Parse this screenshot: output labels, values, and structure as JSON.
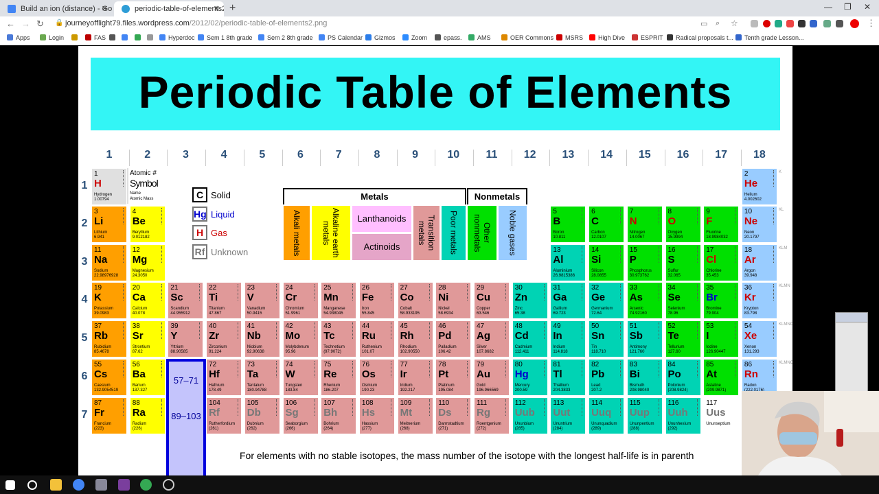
{
  "browser": {
    "tabs": [
      {
        "title": "Build an ion (distance) - Google",
        "favicon_color": "#4285f4"
      },
      {
        "title": "periodic-table-of-elements2.png",
        "favicon_color": "#2e9dd6"
      }
    ],
    "url_host": "journeyofflight79.files.wordpress.com",
    "url_path": "/2012/02/periodic-table-of-elements2.png",
    "bookmarks": [
      "Apps",
      "Login",
      "FAS",
      "",
      "",
      "",
      "Hyperdoc",
      "Sem 1 8th grade",
      "Sem 2 8th grade",
      "PS Calendar",
      "Gizmos",
      "Zoom",
      "epass.",
      "AMS",
      "OER Commons",
      "MSRS",
      "High Dive",
      "ESPRIT",
      "Radical proposals t...",
      "Tenth grade Lesson..."
    ]
  },
  "page": {
    "title": "Periodic Table of Elements",
    "groups": [
      "1",
      "2",
      "3",
      "4",
      "5",
      "6",
      "7",
      "8",
      "9",
      "10",
      "11",
      "12",
      "13",
      "14",
      "15",
      "16",
      "17",
      "18"
    ],
    "periods": [
      "1",
      "2",
      "3",
      "4",
      "5",
      "6",
      "7"
    ],
    "legend": {
      "atomic_label": "Atomic #",
      "symbol_label": "Symbol",
      "name_label": "Name",
      "mass_label": "Atomic Mass",
      "states": [
        {
          "sym": "C",
          "label": "Solid",
          "color": "#000000"
        },
        {
          "sym": "Hg",
          "label": "Liquid",
          "color": "#0000cc"
        },
        {
          "sym": "H",
          "label": "Gas",
          "color": "#cc0000"
        },
        {
          "sym": "Rf",
          "label": "Unknown",
          "color": "#777777"
        }
      ],
      "metals_header": "Metals",
      "nonmetals_header": "Nonmetals",
      "categories": [
        "Alkali metals",
        "Alkaline earth metals",
        "Lanthanoids",
        "Actinoids",
        "Transition metals",
        "Poor metals",
        "Other nonmetals",
        "Noble gases"
      ]
    },
    "lanthanoid_range": "57–71",
    "actinoid_range": "89–103",
    "footnote": "For elements with no stable isotopes, the mass number of the isotope with the longest half-life is in parenth",
    "shell_labels": [
      "K",
      "KL",
      "KLM",
      "KLMN",
      "KLMNO",
      "KLMNOP",
      "KLMNOPQ"
    ]
  },
  "colors": {
    "alkali": "#ff9f00",
    "alkaline": "#ffff00",
    "transition": "#e09999",
    "poor": "#00d3b4",
    "nonmetal": "#00e000",
    "noble": "#99ccff",
    "lanthanoid": "#ffbfff",
    "actinoid": "#e5a5c8",
    "halogen": "#f7ff46",
    "unknown": "#e8e8e8",
    "hydrogen": "#e0e0e0",
    "cyan": "#33f5f5"
  },
  "elements": [
    {
      "z": "1",
      "s": "H",
      "n": "Hydrogen",
      "m": "1.00794",
      "g": 1,
      "p": 1,
      "c": "hydrogen",
      "st": "gas"
    },
    {
      "z": "2",
      "s": "He",
      "n": "Helium",
      "m": "4.002602",
      "g": 18,
      "p": 1,
      "c": "noble",
      "st": "gas"
    },
    {
      "z": "3",
      "s": "Li",
      "n": "Lithium",
      "m": "6.941",
      "g": 1,
      "p": 2,
      "c": "alkali",
      "st": "solid"
    },
    {
      "z": "4",
      "s": "Be",
      "n": "Beryllium",
      "m": "9.012182",
      "g": 2,
      "p": 2,
      "c": "alkaline",
      "st": "solid"
    },
    {
      "z": "5",
      "s": "B",
      "n": "Boron",
      "m": "10.811",
      "g": 13,
      "p": 2,
      "c": "nonmetal",
      "st": "solid"
    },
    {
      "z": "6",
      "s": "C",
      "n": "Carbon",
      "m": "12.0107",
      "g": 14,
      "p": 2,
      "c": "nonmetal",
      "st": "solid"
    },
    {
      "z": "7",
      "s": "N",
      "n": "Nitrogen",
      "m": "14.0067",
      "g": 15,
      "p": 2,
      "c": "nonmetal",
      "st": "gas"
    },
    {
      "z": "8",
      "s": "O",
      "n": "Oxygen",
      "m": "15.9994",
      "g": 16,
      "p": 2,
      "c": "nonmetal",
      "st": "gas"
    },
    {
      "z": "9",
      "s": "F",
      "n": "Fluorine",
      "m": "18.9984032",
      "g": 17,
      "p": 2,
      "c": "nonmetal",
      "st": "gas"
    },
    {
      "z": "10",
      "s": "Ne",
      "n": "Neon",
      "m": "20.1797",
      "g": 18,
      "p": 2,
      "c": "noble",
      "st": "gas"
    },
    {
      "z": "11",
      "s": "Na",
      "n": "Sodium",
      "m": "22.98976928",
      "g": 1,
      "p": 3,
      "c": "alkali",
      "st": "solid"
    },
    {
      "z": "12",
      "s": "Mg",
      "n": "Magnesium",
      "m": "24.3050",
      "g": 2,
      "p": 3,
      "c": "alkaline",
      "st": "solid"
    },
    {
      "z": "13",
      "s": "Al",
      "n": "Aluminium",
      "m": "26.9815386",
      "g": 13,
      "p": 3,
      "c": "poor",
      "st": "solid"
    },
    {
      "z": "14",
      "s": "Si",
      "n": "Silicon",
      "m": "28.0855",
      "g": 14,
      "p": 3,
      "c": "nonmetal",
      "st": "solid"
    },
    {
      "z": "15",
      "s": "P",
      "n": "Phosphorus",
      "m": "30.973762",
      "g": 15,
      "p": 3,
      "c": "nonmetal",
      "st": "solid"
    },
    {
      "z": "16",
      "s": "S",
      "n": "Sulfur",
      "m": "32.065",
      "g": 16,
      "p": 3,
      "c": "nonmetal",
      "st": "solid"
    },
    {
      "z": "17",
      "s": "Cl",
      "n": "Chlorine",
      "m": "35.453",
      "g": 17,
      "p": 3,
      "c": "nonmetal",
      "st": "gas"
    },
    {
      "z": "18",
      "s": "Ar",
      "n": "Argon",
      "m": "39.948",
      "g": 18,
      "p": 3,
      "c": "noble",
      "st": "gas"
    },
    {
      "z": "19",
      "s": "K",
      "n": "Potassium",
      "m": "39.0983",
      "g": 1,
      "p": 4,
      "c": "alkali",
      "st": "solid"
    },
    {
      "z": "20",
      "s": "Ca",
      "n": "Calcium",
      "m": "40.078",
      "g": 2,
      "p": 4,
      "c": "alkaline",
      "st": "solid"
    },
    {
      "z": "21",
      "s": "Sc",
      "n": "Scandium",
      "m": "44.955912",
      "g": 3,
      "p": 4,
      "c": "transition",
      "st": "solid"
    },
    {
      "z": "22",
      "s": "Ti",
      "n": "Titanium",
      "m": "47.867",
      "g": 4,
      "p": 4,
      "c": "transition",
      "st": "solid"
    },
    {
      "z": "23",
      "s": "V",
      "n": "Vanadium",
      "m": "50.9415",
      "g": 5,
      "p": 4,
      "c": "transition",
      "st": "solid"
    },
    {
      "z": "24",
      "s": "Cr",
      "n": "Chromium",
      "m": "51.9961",
      "g": 6,
      "p": 4,
      "c": "transition",
      "st": "solid"
    },
    {
      "z": "25",
      "s": "Mn",
      "n": "Manganese",
      "m": "54.938045",
      "g": 7,
      "p": 4,
      "c": "transition",
      "st": "solid"
    },
    {
      "z": "26",
      "s": "Fe",
      "n": "Iron",
      "m": "55.845",
      "g": 8,
      "p": 4,
      "c": "transition",
      "st": "solid"
    },
    {
      "z": "27",
      "s": "Co",
      "n": "Cobalt",
      "m": "58.933195",
      "g": 9,
      "p": 4,
      "c": "transition",
      "st": "solid"
    },
    {
      "z": "28",
      "s": "Ni",
      "n": "Nickel",
      "m": "58.6934",
      "g": 10,
      "p": 4,
      "c": "transition",
      "st": "solid"
    },
    {
      "z": "29",
      "s": "Cu",
      "n": "Copper",
      "m": "63.546",
      "g": 11,
      "p": 4,
      "c": "transition",
      "st": "solid"
    },
    {
      "z": "30",
      "s": "Zn",
      "n": "Zinc",
      "m": "65.38",
      "g": 12,
      "p": 4,
      "c": "poor",
      "st": "solid"
    },
    {
      "z": "31",
      "s": "Ga",
      "n": "Gallium",
      "m": "69.723",
      "g": 13,
      "p": 4,
      "c": "poor",
      "st": "solid"
    },
    {
      "z": "32",
      "s": "Ge",
      "n": "Germanium",
      "m": "72.64",
      "g": 14,
      "p": 4,
      "c": "poor",
      "st": "solid"
    },
    {
      "z": "33",
      "s": "As",
      "n": "Arsenic",
      "m": "74.92160",
      "g": 15,
      "p": 4,
      "c": "nonmetal",
      "st": "solid"
    },
    {
      "z": "34",
      "s": "Se",
      "n": "Selenium",
      "m": "78.96",
      "g": 16,
      "p": 4,
      "c": "nonmetal",
      "st": "solid"
    },
    {
      "z": "35",
      "s": "Br",
      "n": "Bromine",
      "m": "79.904",
      "g": 17,
      "p": 4,
      "c": "nonmetal",
      "st": "liquid"
    },
    {
      "z": "36",
      "s": "Kr",
      "n": "Krypton",
      "m": "83.798",
      "g": 18,
      "p": 4,
      "c": "noble",
      "st": "gas"
    },
    {
      "z": "37",
      "s": "Rb",
      "n": "Rubidium",
      "m": "85.4678",
      "g": 1,
      "p": 5,
      "c": "alkali",
      "st": "solid"
    },
    {
      "z": "38",
      "s": "Sr",
      "n": "Strontium",
      "m": "87.62",
      "g": 2,
      "p": 5,
      "c": "alkaline",
      "st": "solid"
    },
    {
      "z": "39",
      "s": "Y",
      "n": "Yttrium",
      "m": "88.90585",
      "g": 3,
      "p": 5,
      "c": "transition",
      "st": "solid"
    },
    {
      "z": "40",
      "s": "Zr",
      "n": "Zirconium",
      "m": "91.224",
      "g": 4,
      "p": 5,
      "c": "transition",
      "st": "solid"
    },
    {
      "z": "41",
      "s": "Nb",
      "n": "Niobium",
      "m": "92.90638",
      "g": 5,
      "p": 5,
      "c": "transition",
      "st": "solid"
    },
    {
      "z": "42",
      "s": "Mo",
      "n": "Molybdenum",
      "m": "95.96",
      "g": 6,
      "p": 5,
      "c": "transition",
      "st": "solid"
    },
    {
      "z": "43",
      "s": "Tc",
      "n": "Technetium",
      "m": "(97.9072)",
      "g": 7,
      "p": 5,
      "c": "transition",
      "st": "solid"
    },
    {
      "z": "44",
      "s": "Ru",
      "n": "Ruthenium",
      "m": "101.07",
      "g": 8,
      "p": 5,
      "c": "transition",
      "st": "solid"
    },
    {
      "z": "45",
      "s": "Rh",
      "n": "Rhodium",
      "m": "102.90550",
      "g": 9,
      "p": 5,
      "c": "transition",
      "st": "solid"
    },
    {
      "z": "46",
      "s": "Pd",
      "n": "Palladium",
      "m": "106.42",
      "g": 10,
      "p": 5,
      "c": "transition",
      "st": "solid"
    },
    {
      "z": "47",
      "s": "Ag",
      "n": "Silver",
      "m": "107.8682",
      "g": 11,
      "p": 5,
      "c": "transition",
      "st": "solid"
    },
    {
      "z": "48",
      "s": "Cd",
      "n": "Cadmium",
      "m": "112.411",
      "g": 12,
      "p": 5,
      "c": "poor",
      "st": "solid"
    },
    {
      "z": "49",
      "s": "In",
      "n": "Indium",
      "m": "114.818",
      "g": 13,
      "p": 5,
      "c": "poor",
      "st": "solid"
    },
    {
      "z": "50",
      "s": "Sn",
      "n": "Tin",
      "m": "118.710",
      "g": 14,
      "p": 5,
      "c": "poor",
      "st": "solid"
    },
    {
      "z": "51",
      "s": "Sb",
      "n": "Antimony",
      "m": "121.760",
      "g": 15,
      "p": 5,
      "c": "poor",
      "st": "solid"
    },
    {
      "z": "52",
      "s": "Te",
      "n": "Tellurium",
      "m": "127.60",
      "g": 16,
      "p": 5,
      "c": "nonmetal",
      "st": "solid"
    },
    {
      "z": "53",
      "s": "I",
      "n": "Iodine",
      "m": "126.90447",
      "g": 17,
      "p": 5,
      "c": "nonmetal",
      "st": "solid"
    },
    {
      "z": "54",
      "s": "Xe",
      "n": "Xenon",
      "m": "131.293",
      "g": 18,
      "p": 5,
      "c": "noble",
      "st": "gas"
    },
    {
      "z": "55",
      "s": "Cs",
      "n": "Caesium",
      "m": "132.9054519",
      "g": 1,
      "p": 6,
      "c": "alkali",
      "st": "solid"
    },
    {
      "z": "56",
      "s": "Ba",
      "n": "Barium",
      "m": "137.327",
      "g": 2,
      "p": 6,
      "c": "alkaline",
      "st": "solid"
    },
    {
      "z": "72",
      "s": "Hf",
      "n": "Hafnium",
      "m": "178.49",
      "g": 4,
      "p": 6,
      "c": "transition",
      "st": "solid"
    },
    {
      "z": "73",
      "s": "Ta",
      "n": "Tantalum",
      "m": "180.94788",
      "g": 5,
      "p": 6,
      "c": "transition",
      "st": "solid"
    },
    {
      "z": "74",
      "s": "W",
      "n": "Tungsten",
      "m": "183.84",
      "g": 6,
      "p": 6,
      "c": "transition",
      "st": "solid"
    },
    {
      "z": "75",
      "s": "Re",
      "n": "Rhenium",
      "m": "186.207",
      "g": 7,
      "p": 6,
      "c": "transition",
      "st": "solid"
    },
    {
      "z": "76",
      "s": "Os",
      "n": "Osmium",
      "m": "190.23",
      "g": 8,
      "p": 6,
      "c": "transition",
      "st": "solid"
    },
    {
      "z": "77",
      "s": "Ir",
      "n": "Iridium",
      "m": "192.217",
      "g": 9,
      "p": 6,
      "c": "transition",
      "st": "solid"
    },
    {
      "z": "78",
      "s": "Pt",
      "n": "Platinum",
      "m": "195.084",
      "g": 10,
      "p": 6,
      "c": "transition",
      "st": "solid"
    },
    {
      "z": "79",
      "s": "Au",
      "n": "Gold",
      "m": "196.966569",
      "g": 11,
      "p": 6,
      "c": "transition",
      "st": "solid"
    },
    {
      "z": "80",
      "s": "Hg",
      "n": "Mercury",
      "m": "200.59",
      "g": 12,
      "p": 6,
      "c": "poor",
      "st": "liquid"
    },
    {
      "z": "81",
      "s": "Tl",
      "n": "Thallium",
      "m": "204.3833",
      "g": 13,
      "p": 6,
      "c": "poor",
      "st": "solid"
    },
    {
      "z": "82",
      "s": "Pb",
      "n": "Lead",
      "m": "207.2",
      "g": 14,
      "p": 6,
      "c": "poor",
      "st": "solid"
    },
    {
      "z": "83",
      "s": "Bi",
      "n": "Bismuth",
      "m": "208.98040",
      "g": 15,
      "p": 6,
      "c": "poor",
      "st": "solid"
    },
    {
      "z": "84",
      "s": "Po",
      "n": "Polonium",
      "m": "(208.9824)",
      "g": 16,
      "p": 6,
      "c": "poor",
      "st": "solid"
    },
    {
      "z": "85",
      "s": "At",
      "n": "Astatine",
      "m": "(209.9871)",
      "g": 17,
      "p": 6,
      "c": "nonmetal",
      "st": "solid"
    },
    {
      "z": "86",
      "s": "Rn",
      "n": "Radon",
      "m": "(222.0176)",
      "g": 18,
      "p": 6,
      "c": "noble",
      "st": "gas"
    },
    {
      "z": "87",
      "s": "Fr",
      "n": "Francium",
      "m": "(223)",
      "g": 1,
      "p": 7,
      "c": "alkali",
      "st": "solid"
    },
    {
      "z": "88",
      "s": "Ra",
      "n": "Radium",
      "m": "(226)",
      "g": 2,
      "p": 7,
      "c": "alkaline",
      "st": "solid"
    },
    {
      "z": "104",
      "s": "Rf",
      "n": "Rutherfordium",
      "m": "(261)",
      "g": 4,
      "p": 7,
      "c": "transition",
      "st": "unknown"
    },
    {
      "z": "105",
      "s": "Db",
      "n": "Dubnium",
      "m": "(262)",
      "g": 5,
      "p": 7,
      "c": "transition",
      "st": "unknown"
    },
    {
      "z": "106",
      "s": "Sg",
      "n": "Seaborgium",
      "m": "(266)",
      "g": 6,
      "p": 7,
      "c": "transition",
      "st": "unknown"
    },
    {
      "z": "107",
      "s": "Bh",
      "n": "Bohrium",
      "m": "(264)",
      "g": 7,
      "p": 7,
      "c": "transition",
      "st": "unknown"
    },
    {
      "z": "108",
      "s": "Hs",
      "n": "Hassium",
      "m": "(277)",
      "g": 8,
      "p": 7,
      "c": "transition",
      "st": "unknown"
    },
    {
      "z": "109",
      "s": "Mt",
      "n": "Meitnerium",
      "m": "(268)",
      "g": 9,
      "p": 7,
      "c": "transition",
      "st": "unknown"
    },
    {
      "z": "110",
      "s": "Ds",
      "n": "Darmstadtium",
      "m": "(271)",
      "g": 10,
      "p": 7,
      "c": "transition",
      "st": "unknown"
    },
    {
      "z": "111",
      "s": "Rg",
      "n": "Roentgenium",
      "m": "(272)",
      "g": 11,
      "p": 7,
      "c": "transition",
      "st": "unknown"
    },
    {
      "z": "112",
      "s": "Uub",
      "n": "Ununbium",
      "m": "(285)",
      "g": 12,
      "p": 7,
      "c": "poor",
      "st": "unknown"
    },
    {
      "z": "113",
      "s": "Uut",
      "n": "Ununtrium",
      "m": "(284)",
      "g": 13,
      "p": 7,
      "c": "poor",
      "st": "unknown"
    },
    {
      "z": "114",
      "s": "Uuq",
      "n": "Ununquadium",
      "m": "(289)",
      "g": 14,
      "p": 7,
      "c": "poor",
      "st": "unknown"
    },
    {
      "z": "115",
      "s": "Uup",
      "n": "Ununpentium",
      "m": "(288)",
      "g": 15,
      "p": 7,
      "c": "poor",
      "st": "unknown"
    },
    {
      "z": "116",
      "s": "Uuh",
      "n": "Ununhexium",
      "m": "(292)",
      "g": 16,
      "p": 7,
      "c": "poor",
      "st": "unknown"
    },
    {
      "z": "117",
      "s": "Uus",
      "n": "Ununseptium",
      "m": "",
      "g": 17,
      "p": 7,
      "c": "blank",
      "st": "unknown"
    }
  ]
}
